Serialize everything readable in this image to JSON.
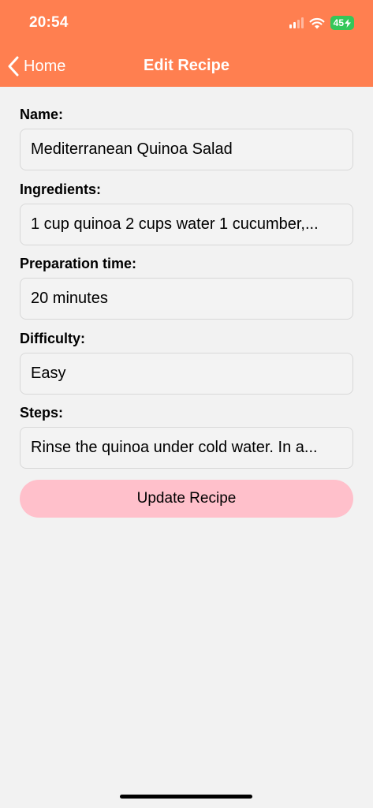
{
  "status_bar": {
    "time": "20:54",
    "battery": "45"
  },
  "nav": {
    "back_label": "Home",
    "title": "Edit Recipe"
  },
  "form": {
    "fields": [
      {
        "label": "Name:",
        "value": "Mediterranean Quinoa Salad"
      },
      {
        "label": "Ingredients:",
        "value": "1 cup quinoa 2 cups water 1 cucumber,..."
      },
      {
        "label": "Preparation time:",
        "value": "20 minutes"
      },
      {
        "label": "Difficulty:",
        "value": "Easy"
      },
      {
        "label": "Steps:",
        "value": "Rinse the quinoa under cold water. In a..."
      }
    ],
    "submit_label": "Update Recipe"
  },
  "colors": {
    "header_bg": "#ff7f50",
    "button_bg": "#ffc0cb",
    "battery": "#34c759"
  }
}
